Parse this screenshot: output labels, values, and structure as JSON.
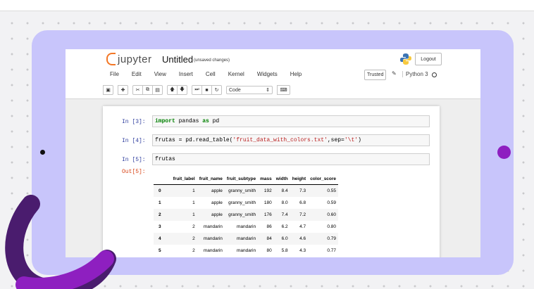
{
  "app": {
    "logo_text": "jupyter",
    "notebook_title": "Untitled",
    "save_status": "(unsaved changes)",
    "logout_label": "Logout"
  },
  "menu": [
    "File",
    "Edit",
    "View",
    "Insert",
    "Cell",
    "Kernel",
    "Widgets",
    "Help"
  ],
  "status": {
    "trusted_label": "Trusted",
    "kernel_name": "Python 3"
  },
  "toolbar": {
    "cell_type": "Code",
    "icons": [
      "save-icon",
      "add-cell-icon",
      "cut-icon",
      "copy-icon",
      "paste-icon",
      "move-up-icon",
      "move-down-icon",
      "run-icon",
      "stop-icon",
      "restart-icon",
      "keyboard-icon"
    ]
  },
  "cells": {
    "c1_prompt": "In [3]:",
    "c2_prompt": "In [4]:",
    "c3_prompt": "In [5]:",
    "c3_code": "frutas",
    "out_prompt": "Out[5]:"
  },
  "table": {
    "headers": [
      "",
      "fruit_label",
      "fruit_name",
      "fruit_subtype",
      "mass",
      "width",
      "height",
      "color_score"
    ],
    "rows": [
      [
        "0",
        "1",
        "apple",
        "granny_smith",
        "192",
        "8.4",
        "7.3",
        "0.55"
      ],
      [
        "1",
        "1",
        "apple",
        "granny_smith",
        "180",
        "8.0",
        "6.8",
        "0.59"
      ],
      [
        "2",
        "1",
        "apple",
        "granny_smith",
        "176",
        "7.4",
        "7.2",
        "0.60"
      ],
      [
        "3",
        "2",
        "mandarin",
        "mandarin",
        "86",
        "6.2",
        "4.7",
        "0.80"
      ],
      [
        "4",
        "2",
        "mandarin",
        "mandarin",
        "84",
        "6.0",
        "4.6",
        "0.79"
      ],
      [
        "5",
        "2",
        "mandarin",
        "mandarin",
        "80",
        "5.8",
        "4.3",
        "0.77"
      ]
    ]
  },
  "colors": {
    "tablet": "#c8c5fb",
    "accent_purple": "#8e1fc0",
    "jupyter_orange": "#f37726"
  }
}
